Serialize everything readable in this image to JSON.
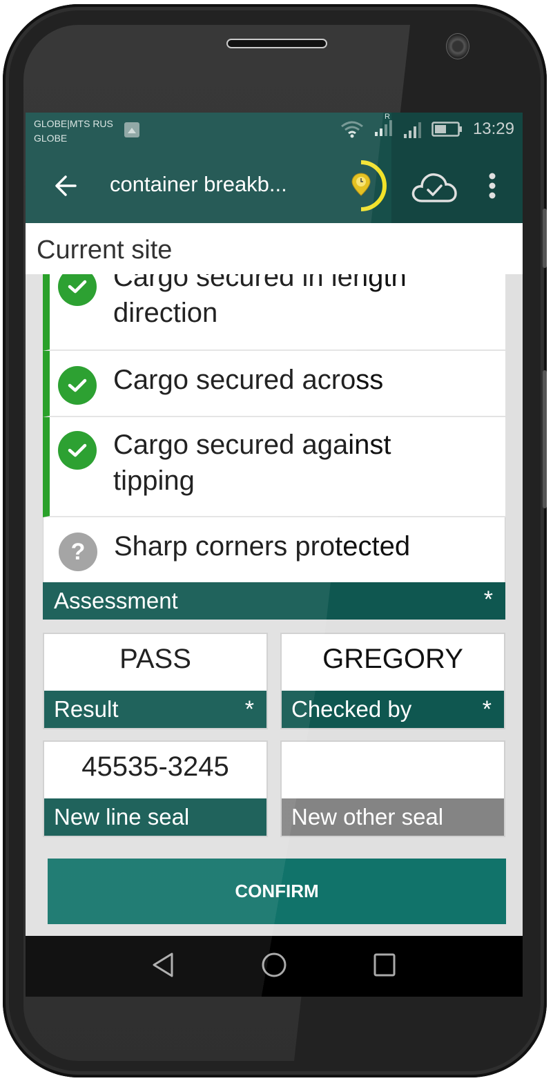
{
  "statusbar": {
    "carrier_line1": "GLOBE|MTS RUS",
    "carrier_line2": "GLOBE",
    "roaming_indicator": "R",
    "time": "13:29",
    "icons": [
      "image-notification-icon",
      "wifi-icon",
      "signal-roaming-icon",
      "signal-icon",
      "battery-icon"
    ]
  },
  "appbar": {
    "title": "container breakb...",
    "icons": [
      "back-arrow-icon",
      "timer-location-icon",
      "cloud-sync-check-icon",
      "more-vert-icon"
    ]
  },
  "site_header": "Current site",
  "checklist": [
    {
      "label": "Cargo secured in length direction",
      "status": "done",
      "icon": "check-circle-icon"
    },
    {
      "label": "Cargo secured across",
      "status": "done",
      "icon": "check-circle-icon"
    },
    {
      "label": "Cargo secured against tipping",
      "status": "done",
      "icon": "check-circle-icon"
    },
    {
      "label": "Sharp corners protected",
      "status": "unknown",
      "icon": "question-circle-icon"
    }
  ],
  "assessment": {
    "label": "Assessment",
    "required_mark": "*"
  },
  "fields": [
    {
      "label": "Result",
      "value": "PASS",
      "required_mark": "*"
    },
    {
      "label": "Checked by",
      "value": "GREGORY",
      "required_mark": "*"
    },
    {
      "label": "New line seal",
      "value": "45535-3245",
      "required_mark": ""
    },
    {
      "label": "New other seal",
      "value": "",
      "required_mark": ""
    }
  ],
  "confirm_label": "CONFIRM",
  "colors": {
    "primary": "#174f4a",
    "section": "#0f5750",
    "button": "#11736a",
    "success": "#1d9a22",
    "timer_ring": "#f2e22a",
    "disabled_label": "#848484"
  },
  "navbar": {
    "icons": [
      "nav-back-icon",
      "nav-home-icon",
      "nav-recents-icon"
    ]
  }
}
